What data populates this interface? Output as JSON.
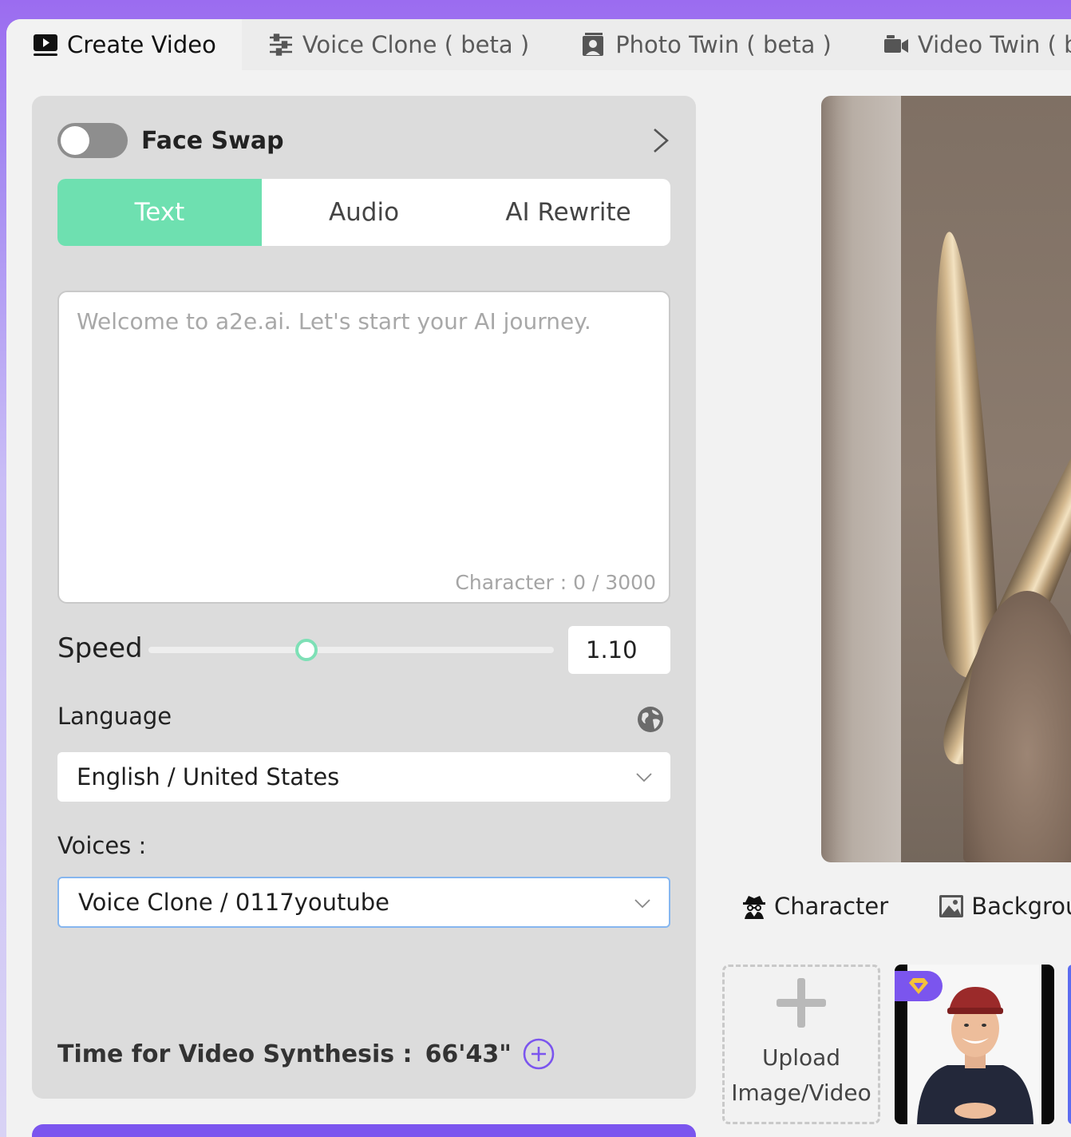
{
  "tabs": [
    {
      "label": "Create Video",
      "icon": "video-play-icon",
      "active": true
    },
    {
      "label": "Voice Clone ( beta )",
      "icon": "sliders-icon",
      "active": false
    },
    {
      "label": "Photo Twin ( beta )",
      "icon": "photo-twin-icon",
      "active": false
    },
    {
      "label": "Video Twin ( beta )",
      "icon": "camera-icon",
      "active": false
    }
  ],
  "face_swap": {
    "label": "Face Swap",
    "enabled": false
  },
  "input_modes": [
    {
      "label": "Text",
      "active": true
    },
    {
      "label": "Audio",
      "active": false
    },
    {
      "label": "AI Rewrite",
      "active": false
    }
  ],
  "script_input": {
    "placeholder": "Welcome to a2e.ai. Let's start your AI journey.",
    "value": "",
    "char_count": "Character : 0 / 3000"
  },
  "speed": {
    "label": "Speed",
    "value": "1.10",
    "level": 0.39
  },
  "language": {
    "label": "Language",
    "selected": "English / United States"
  },
  "voices": {
    "label": "Voices :",
    "selected": "Voice Clone / 0117youtube"
  },
  "synthesis": {
    "label": "Time for Video Synthesis :",
    "value": "66'43\""
  },
  "media_tabs": [
    {
      "label": "Character",
      "icon": "spy-icon"
    },
    {
      "label": "Backgrou",
      "icon": "image-icon"
    }
  ],
  "upload": {
    "label_line1": "Upload",
    "label_line2": "Image/Video"
  },
  "colors": {
    "accent_purple": "#7b55ee",
    "active_tab_green": "#6ee0b0",
    "panel_gray": "#dcdcdc"
  }
}
